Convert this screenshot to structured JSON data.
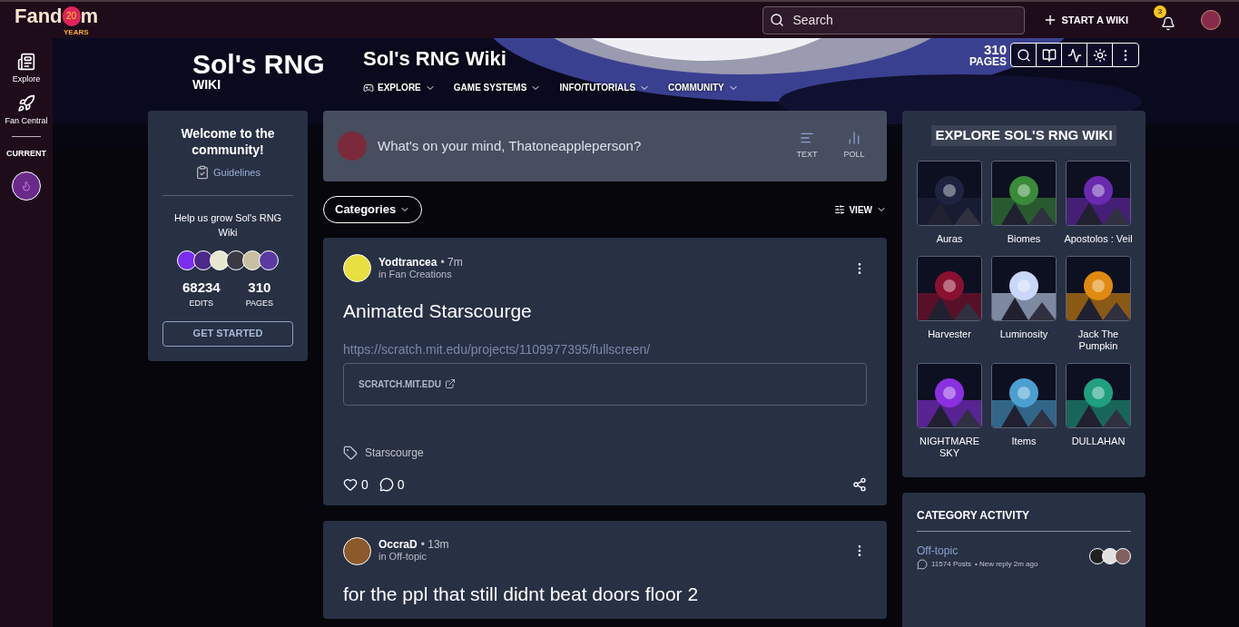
{
  "topbar": {
    "logo": {
      "left": "Fand",
      "badge": "20",
      "right": "m",
      "sub": "YEARS"
    },
    "search": {
      "placeholder": "Search"
    },
    "start_wiki": "START A WIKI",
    "notifications": "3"
  },
  "rail": {
    "items": [
      {
        "label": "Explore",
        "kind": "explore"
      },
      {
        "label": "Fan Central",
        "kind": "rocket"
      }
    ],
    "current_label": "CURRENT"
  },
  "wiki_header": {
    "logo_main": "Sol's RNG",
    "logo_sub": "WIKI",
    "title": "Sol's RNG Wiki",
    "nav": [
      {
        "label": "EXPLORE",
        "kind": "icon"
      },
      {
        "label": "GAME SYSTEMS",
        "kind": "plain"
      },
      {
        "label": "INFO/TUTORIALS",
        "kind": "plain"
      },
      {
        "label": "COMMUNITY",
        "kind": "plain"
      }
    ],
    "pages_count": "310",
    "pages_label": "PAGES"
  },
  "welcome": {
    "title": "Welcome to the community!",
    "guidelines": "Guidelines",
    "help": "Help us grow Sol's RNG Wiki",
    "stats": [
      {
        "value": "68234",
        "label": "EDITS"
      },
      {
        "value": "310",
        "label": "PAGES"
      }
    ],
    "button": "GET STARTED"
  },
  "composer": {
    "placeholder": "What's on your mind, Thatoneappleperson?",
    "actions": [
      {
        "label": "TEXT",
        "kind": "text"
      },
      {
        "label": "POLL",
        "kind": "poll"
      }
    ]
  },
  "filters": {
    "categories": "Categories",
    "view": "VIEW"
  },
  "posts": [
    {
      "author": "Yodtrancea",
      "time": "• 7m",
      "category": "in Fan Creations",
      "title": "Animated Starscourge",
      "link": "https://scratch.mit.edu/projects/1109977395/fullscreen/",
      "embed": "SCRATCH.MIT.EDU",
      "tag": "Starscourge",
      "likes": "0",
      "comments": "0"
    },
    {
      "author": "OccraD",
      "time": "• 13m",
      "category": "in Off-topic",
      "title": "for the ppl that still didnt beat doors floor 2"
    }
  ],
  "explore": {
    "title": "EXPLORE SOL'S RNG WIKI",
    "items": [
      {
        "label": "Auras"
      },
      {
        "label": "Biomes"
      },
      {
        "label": "Apostolos : Veil"
      },
      {
        "label": "Harvester"
      },
      {
        "label": "Luminosity"
      },
      {
        "label": "Jack The Pumpkin"
      },
      {
        "label": "NIGHTMARE SKY"
      },
      {
        "label": "Items"
      },
      {
        "label": "DULLAHAN"
      }
    ]
  },
  "category_activity": {
    "title": "CATEGORY ACTIVITY",
    "items": [
      {
        "name": "Off-topic",
        "posts": "11574 Posts",
        "reply": "• New reply 2m ago"
      }
    ]
  }
}
